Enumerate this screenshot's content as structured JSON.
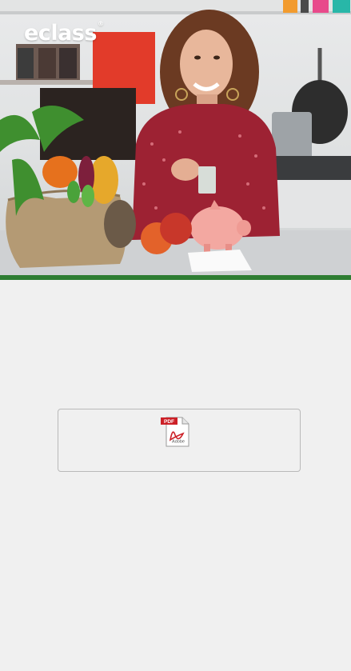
{
  "brand": {
    "logo_text": "eclass",
    "logo_mark": "®",
    "accent_color": "#2e7d32"
  },
  "hero": {
    "image": "woman-in-kitchen-with-piggy-bank-and-vegetables"
  },
  "attachment": {
    "type_label": "PDF",
    "vendor_label": "Adobe",
    "icon": "pdf-file-icon"
  }
}
